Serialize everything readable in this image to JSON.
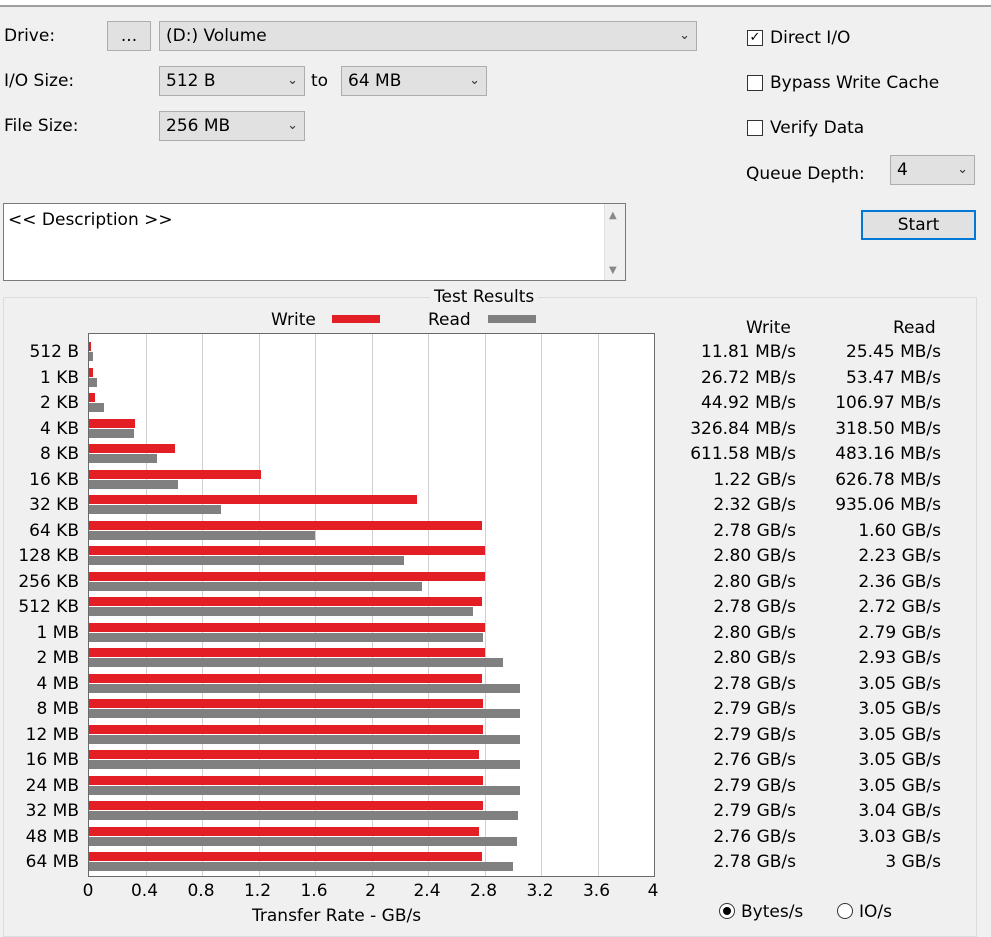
{
  "controls": {
    "drive_label": "Drive:",
    "browse_label": "...",
    "drive_value": "(D:) Volume",
    "io_size_label": "I/O Size:",
    "io_min": "512 B",
    "to_label": "to",
    "io_max": "64 MB",
    "file_size_label": "File Size:",
    "file_size": "256 MB",
    "direct_io_label": "Direct I/O",
    "direct_io_checked": true,
    "bypass_label": "Bypass Write Cache",
    "bypass_checked": false,
    "verify_label": "Verify Data",
    "verify_checked": false,
    "queue_label": "Queue Depth:",
    "queue_value": "4",
    "start_label": "Start",
    "description": "<< Description >>"
  },
  "results": {
    "group_title": "Test Results",
    "write_header": "Write",
    "read_header": "Read",
    "radio_bytes": "Bytes/s",
    "radio_io": "IO/s",
    "selected": "bytes",
    "rows": [
      {
        "size": "512 B",
        "write": "11.81 MB/s",
        "read": "25.45 MB/s"
      },
      {
        "size": "1 KB",
        "write": "26.72 MB/s",
        "read": "53.47 MB/s"
      },
      {
        "size": "2 KB",
        "write": "44.92 MB/s",
        "read": "106.97 MB/s"
      },
      {
        "size": "4 KB",
        "write": "326.84 MB/s",
        "read": "318.50 MB/s"
      },
      {
        "size": "8 KB",
        "write": "611.58 MB/s",
        "read": "483.16 MB/s"
      },
      {
        "size": "16 KB",
        "write": "1.22 GB/s",
        "read": "626.78 MB/s"
      },
      {
        "size": "32 KB",
        "write": "2.32 GB/s",
        "read": "935.06 MB/s"
      },
      {
        "size": "64 KB",
        "write": "2.78 GB/s",
        "read": "1.60 GB/s"
      },
      {
        "size": "128 KB",
        "write": "2.80 GB/s",
        "read": "2.23 GB/s"
      },
      {
        "size": "256 KB",
        "write": "2.80 GB/s",
        "read": "2.36 GB/s"
      },
      {
        "size": "512 KB",
        "write": "2.78 GB/s",
        "read": "2.72 GB/s"
      },
      {
        "size": "1 MB",
        "write": "2.80 GB/s",
        "read": "2.79 GB/s"
      },
      {
        "size": "2 MB",
        "write": "2.80 GB/s",
        "read": "2.93 GB/s"
      },
      {
        "size": "4 MB",
        "write": "2.78 GB/s",
        "read": "3.05 GB/s"
      },
      {
        "size": "8 MB",
        "write": "2.79 GB/s",
        "read": "3.05 GB/s"
      },
      {
        "size": "12 MB",
        "write": "2.79 GB/s",
        "read": "3.05 GB/s"
      },
      {
        "size": "16 MB",
        "write": "2.76 GB/s",
        "read": "3.05 GB/s"
      },
      {
        "size": "24 MB",
        "write": "2.79 GB/s",
        "read": "3.05 GB/s"
      },
      {
        "size": "32 MB",
        "write": "2.79 GB/s",
        "read": "3.04 GB/s"
      },
      {
        "size": "48 MB",
        "write": "2.76 GB/s",
        "read": "3.03 GB/s"
      },
      {
        "size": "64 MB",
        "write": "2.78 GB/s",
        "read": "3 GB/s"
      }
    ]
  },
  "chart_data": {
    "type": "bar",
    "orientation": "horizontal",
    "xlabel": "Transfer Rate - GB/s",
    "xlim": [
      0,
      4
    ],
    "xticks": [
      "0",
      "0.4",
      "0.8",
      "1.2",
      "1.6",
      "2",
      "2.4",
      "2.8",
      "3.2",
      "3.6",
      "4"
    ],
    "legend_position": "top",
    "categories": [
      "512 B",
      "1 KB",
      "2 KB",
      "4 KB",
      "8 KB",
      "16 KB",
      "32 KB",
      "64 KB",
      "128 KB",
      "256 KB",
      "512 KB",
      "1 MB",
      "2 MB",
      "4 MB",
      "8 MB",
      "12 MB",
      "16 MB",
      "24 MB",
      "32 MB",
      "48 MB",
      "64 MB"
    ],
    "series": [
      {
        "name": "Write",
        "color": "#e31e24",
        "values": [
          0.01181,
          0.02672,
          0.04492,
          0.32684,
          0.61158,
          1.22,
          2.32,
          2.78,
          2.8,
          2.8,
          2.78,
          2.8,
          2.8,
          2.78,
          2.79,
          2.79,
          2.76,
          2.79,
          2.79,
          2.76,
          2.78
        ]
      },
      {
        "name": "Read",
        "color": "#808080",
        "values": [
          0.02545,
          0.05347,
          0.10697,
          0.3185,
          0.48316,
          0.62678,
          0.93506,
          1.6,
          2.23,
          2.36,
          2.72,
          2.79,
          2.93,
          3.05,
          3.05,
          3.05,
          3.05,
          3.05,
          3.04,
          3.03,
          3.0
        ]
      }
    ]
  }
}
